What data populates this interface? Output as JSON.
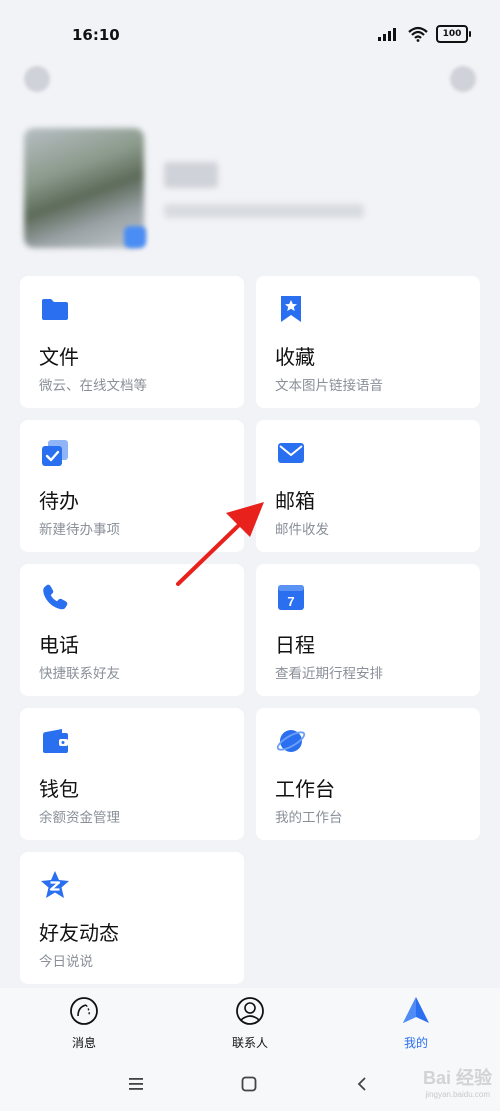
{
  "status_bar": {
    "time": "16:10",
    "battery": "100"
  },
  "cards": [
    {
      "title": "文件",
      "subtitle": "微云、在线文档等",
      "icon": "folder-icon"
    },
    {
      "title": "收藏",
      "subtitle": "文本图片链接语音",
      "icon": "bookmark-star-icon"
    },
    {
      "title": "待办",
      "subtitle": "新建待办事项",
      "icon": "todo-check-icon"
    },
    {
      "title": "邮箱",
      "subtitle": "邮件收发",
      "icon": "mail-icon"
    },
    {
      "title": "电话",
      "subtitle": "快捷联系好友",
      "icon": "phone-icon"
    },
    {
      "title": "日程",
      "subtitle": "查看近期行程安排",
      "icon": "calendar-icon",
      "icon_text": "7"
    },
    {
      "title": "钱包",
      "subtitle": "余额资金管理",
      "icon": "wallet-icon"
    },
    {
      "title": "工作台",
      "subtitle": "我的工作台",
      "icon": "planet-icon"
    },
    {
      "title": "好友动态",
      "subtitle": "今日说说",
      "icon": "qzone-star-icon"
    }
  ],
  "tabs": [
    {
      "label": "消息",
      "icon": "message-tab-icon"
    },
    {
      "label": "联系人",
      "icon": "contacts-tab-icon"
    },
    {
      "label": "我的",
      "icon": "me-tab-icon",
      "active": true
    }
  ],
  "watermark": {
    "text": "Bai 经验",
    "sub": "jingyan.baidu.com"
  },
  "colors": {
    "accent": "#2a6ff0",
    "annotation_arrow": "#e8211c",
    "background": "#f2f3f7"
  }
}
